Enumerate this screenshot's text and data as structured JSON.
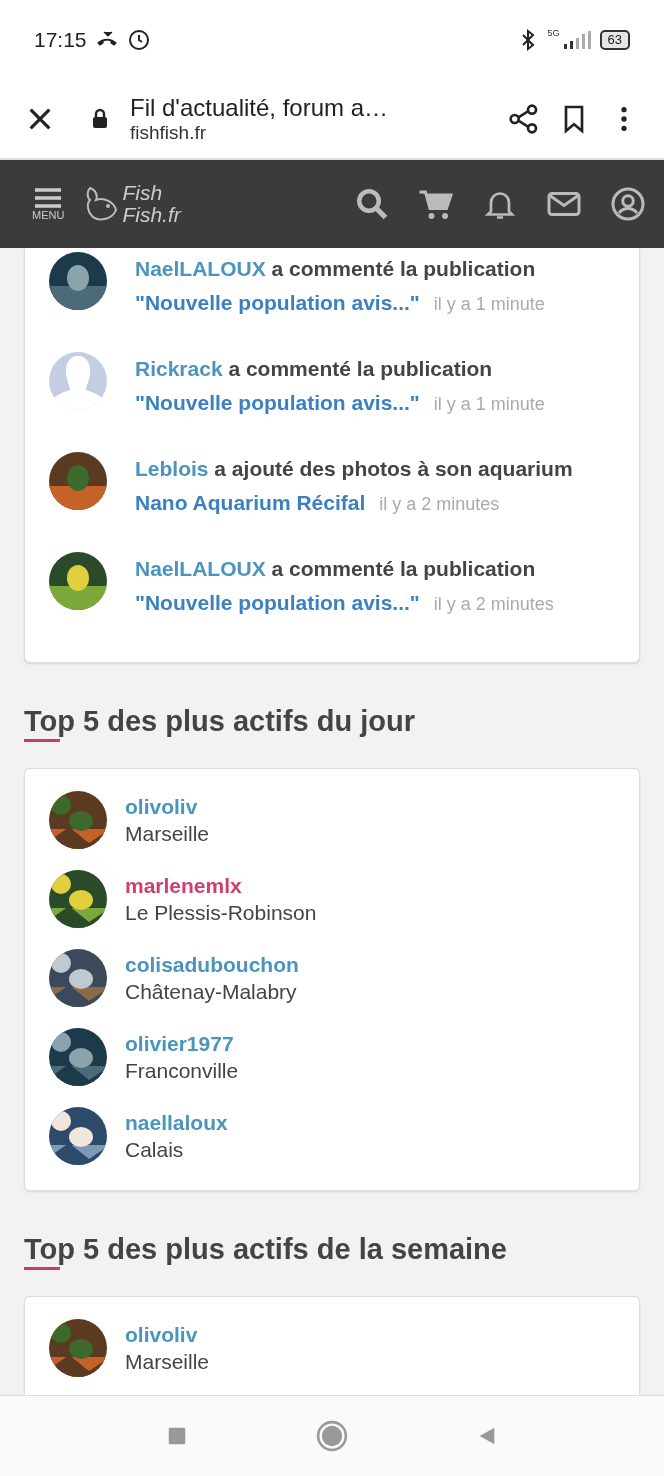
{
  "status_bar": {
    "time": "17:15",
    "network": "5G",
    "battery": "63"
  },
  "browser": {
    "title": "Fil d'actualité, forum a…",
    "url": "fishfish.fr"
  },
  "site_nav": {
    "menu_label": "MENU",
    "logo_line1": "Fish",
    "logo_line2": "Fish.fr"
  },
  "activity": [
    {
      "user": "NaelLALOUX",
      "action": "a commenté la publication",
      "target": "\"Nouvelle population avis...\"",
      "time": "il y a 1 minute"
    },
    {
      "user": "Rickrack",
      "action": "a commenté la publication",
      "target": "\"Nouvelle population avis...\"",
      "time": "il y a 1 minute",
      "avatar": {
        "kind": "silhouette"
      }
    },
    {
      "user": "Leblois",
      "action": "a ajouté des photos à son aquarium",
      "target": "Nano Aquarium Récifal",
      "time": "il y a 2 minutes"
    },
    {
      "user": "NaelLALOUX",
      "action": "a commenté la publication",
      "target": "\"Nouvelle population avis...\"",
      "time": "il y a 2 minutes"
    }
  ],
  "sections": [
    {
      "title": "Top 5 des plus actifs du jour",
      "users": [
        {
          "name": "olivoliv",
          "city": "Marseille",
          "color": "#4a94bd"
        },
        {
          "name": "marlenemlx",
          "city": "Le Plessis-Robinson",
          "color": "#d0406e"
        },
        {
          "name": "colisadubouchon",
          "city": "Châtenay-Malabry",
          "color": "#4a94bd"
        },
        {
          "name": "olivier1977",
          "city": "Franconville",
          "color": "#4a94bd"
        },
        {
          "name": "naellaloux",
          "city": "Calais",
          "color": "#4a94bd"
        }
      ]
    },
    {
      "title": "Top 5 des plus actifs de la semaine",
      "users": [
        {
          "name": "olivoliv",
          "city": "Marseille",
          "color": "#4a94bd"
        }
      ]
    }
  ]
}
